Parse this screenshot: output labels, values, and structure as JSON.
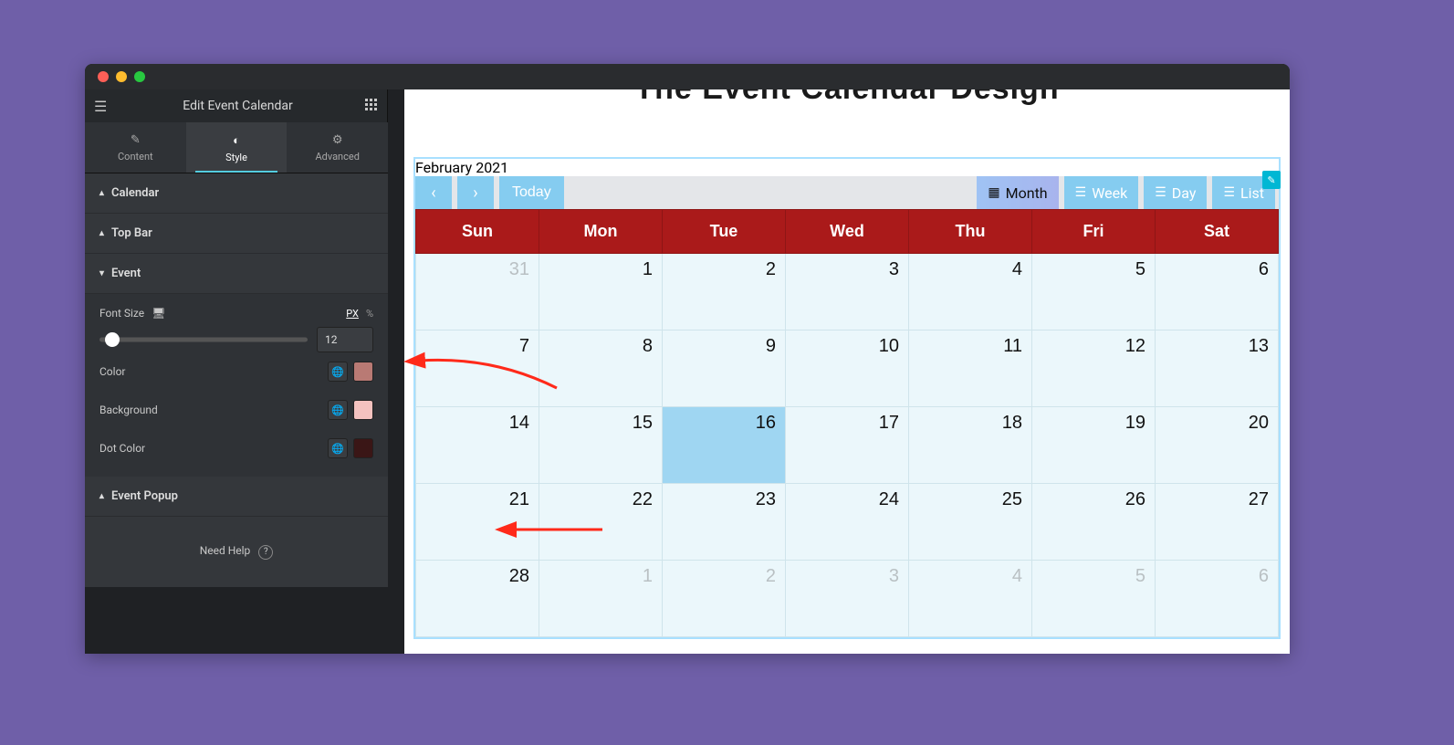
{
  "panel": {
    "title": "Edit Event Calendar",
    "tabs": {
      "content": "Content",
      "style": "Style",
      "advanced": "Advanced"
    },
    "sections": {
      "calendar": "Calendar",
      "topbar": "Top Bar",
      "event": "Event",
      "popup": "Event Popup"
    },
    "event": {
      "font_size_label": "Font Size",
      "unit_px": "PX",
      "unit_pct": "%",
      "font_size_value": "12",
      "color_label": "Color",
      "background_label": "Background",
      "dot_color_label": "Dot Color",
      "colors": {
        "color": "#b97a74",
        "background": "#f4c2bf",
        "dot": "#3a1616"
      }
    },
    "help": "Need Help"
  },
  "preview": {
    "page_title": "The Event Calendar Design",
    "topbar": {
      "today": "Today",
      "month_label": "February 2021",
      "views": {
        "month": "Month",
        "week": "Week",
        "day": "Day",
        "list": "List"
      }
    },
    "day_headers": [
      "Sun",
      "Mon",
      "Tue",
      "Wed",
      "Thu",
      "Fri",
      "Sat"
    ],
    "weeks": [
      [
        {
          "n": "31",
          "other": true
        },
        {
          "n": "1"
        },
        {
          "n": "2"
        },
        {
          "n": "3"
        },
        {
          "n": "4"
        },
        {
          "n": "5"
        },
        {
          "n": "6"
        }
      ],
      [
        {
          "n": "7"
        },
        {
          "n": "8"
        },
        {
          "n": "9"
        },
        {
          "n": "10"
        },
        {
          "n": "11"
        },
        {
          "n": "12"
        },
        {
          "n": "13"
        }
      ],
      [
        {
          "n": "14"
        },
        {
          "n": "15"
        },
        {
          "n": "16",
          "today": true
        },
        {
          "n": "17"
        },
        {
          "n": "18"
        },
        {
          "n": "19"
        },
        {
          "n": "20"
        }
      ],
      [
        {
          "n": "21"
        },
        {
          "n": "22"
        },
        {
          "n": "23"
        },
        {
          "n": "24"
        },
        {
          "n": "25"
        },
        {
          "n": "26"
        },
        {
          "n": "27"
        }
      ],
      [
        {
          "n": "28"
        },
        {
          "n": "1",
          "other": true
        },
        {
          "n": "2",
          "other": true
        },
        {
          "n": "3",
          "other": true
        },
        {
          "n": "4",
          "other": true
        },
        {
          "n": "5",
          "other": true
        },
        {
          "n": "6",
          "other": true
        }
      ]
    ]
  }
}
